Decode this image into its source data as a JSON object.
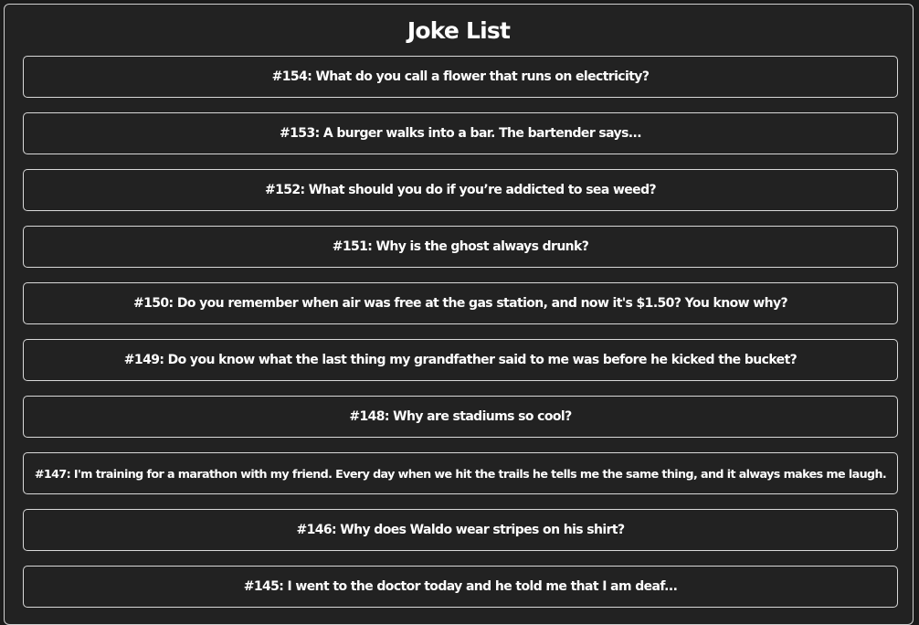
{
  "page": {
    "title": "Joke List"
  },
  "jokes": [
    {
      "label": "#154: What do you call a flower that runs on electricity?"
    },
    {
      "label": "#153: A burger walks into a bar. The bartender says..."
    },
    {
      "label": "#152: What should you do if you’re addicted to sea weed?"
    },
    {
      "label": "#151: Why is the ghost always drunk?"
    },
    {
      "label": "#150: Do you remember when air was free at the gas station, and now it's $1.50? You know why?"
    },
    {
      "label": "#149: Do you know what the last thing my grandfather said to me was before he kicked the bucket?"
    },
    {
      "label": "#148: Why are stadiums so cool?"
    },
    {
      "label": "#147: I'm training for a marathon with my friend. Every day when we hit the trails he tells me the same thing, and it always makes me laugh."
    },
    {
      "label": "#146: Why does Waldo wear stripes on his shirt?"
    },
    {
      "label": "#145: I went to the doctor today and he told me that I am deaf..."
    }
  ],
  "colors": {
    "background": "#222222",
    "border": "#d9d9d9",
    "text": "#ffffff"
  }
}
